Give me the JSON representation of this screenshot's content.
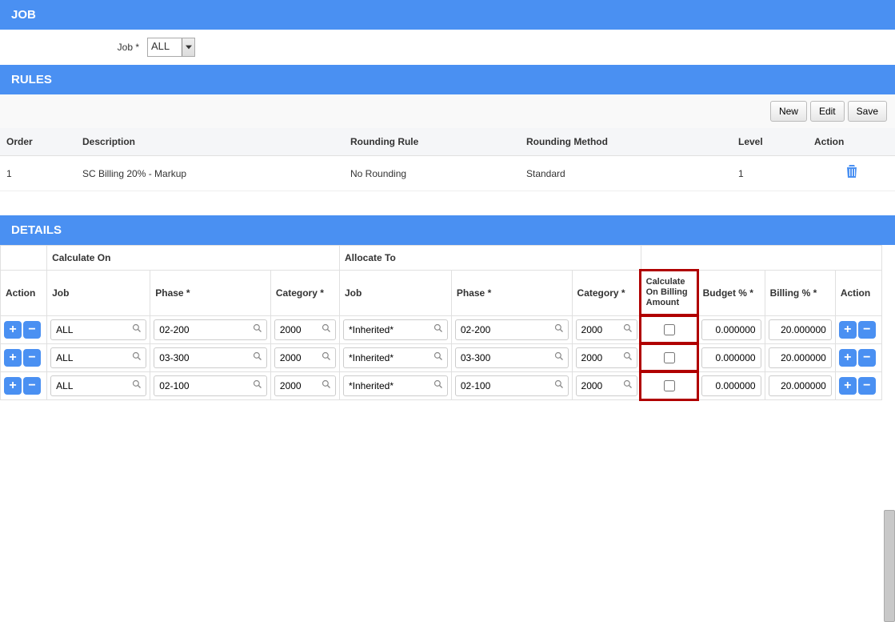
{
  "sections": {
    "job": "JOB",
    "rules": "RULES",
    "details": "DETAILS"
  },
  "jobField": {
    "label": "Job *",
    "value": "ALL"
  },
  "toolbar": {
    "new": "New",
    "edit": "Edit",
    "save": "Save"
  },
  "rulesHeaders": {
    "order": "Order",
    "description": "Description",
    "roundingRule": "Rounding Rule",
    "roundingMethod": "Rounding Method",
    "level": "Level",
    "action": "Action"
  },
  "rulesRow": {
    "order": "1",
    "description": "SC Billing 20% - Markup",
    "roundingRule": "No Rounding",
    "roundingMethod": "Standard",
    "level": "1"
  },
  "detailsGroups": {
    "calcOn": "Calculate On",
    "allocTo": "Allocate To"
  },
  "detailsHeaders": {
    "action": "Action",
    "job": "Job",
    "phase": "Phase *",
    "category": "Category *",
    "calcOnBilling": "Calculate On Billing Amount",
    "budget": "Budget % *",
    "billing": "Billing % *"
  },
  "detailRows": [
    {
      "co_job": "ALL",
      "co_phase": "02-200",
      "co_cat": "2000",
      "at_job": "*Inherited*",
      "at_phase": "02-200",
      "at_cat": "2000",
      "chk": false,
      "budget": "0.000000",
      "billing": "20.000000"
    },
    {
      "co_job": "ALL",
      "co_phase": "03-300",
      "co_cat": "2000",
      "at_job": "*Inherited*",
      "at_phase": "03-300",
      "at_cat": "2000",
      "chk": false,
      "budget": "0.000000",
      "billing": "20.000000"
    },
    {
      "co_job": "ALL",
      "co_phase": "02-100",
      "co_cat": "2000",
      "at_job": "*Inherited*",
      "at_phase": "02-100",
      "at_cat": "2000",
      "chk": false,
      "budget": "0.000000",
      "billing": "20.000000"
    }
  ]
}
